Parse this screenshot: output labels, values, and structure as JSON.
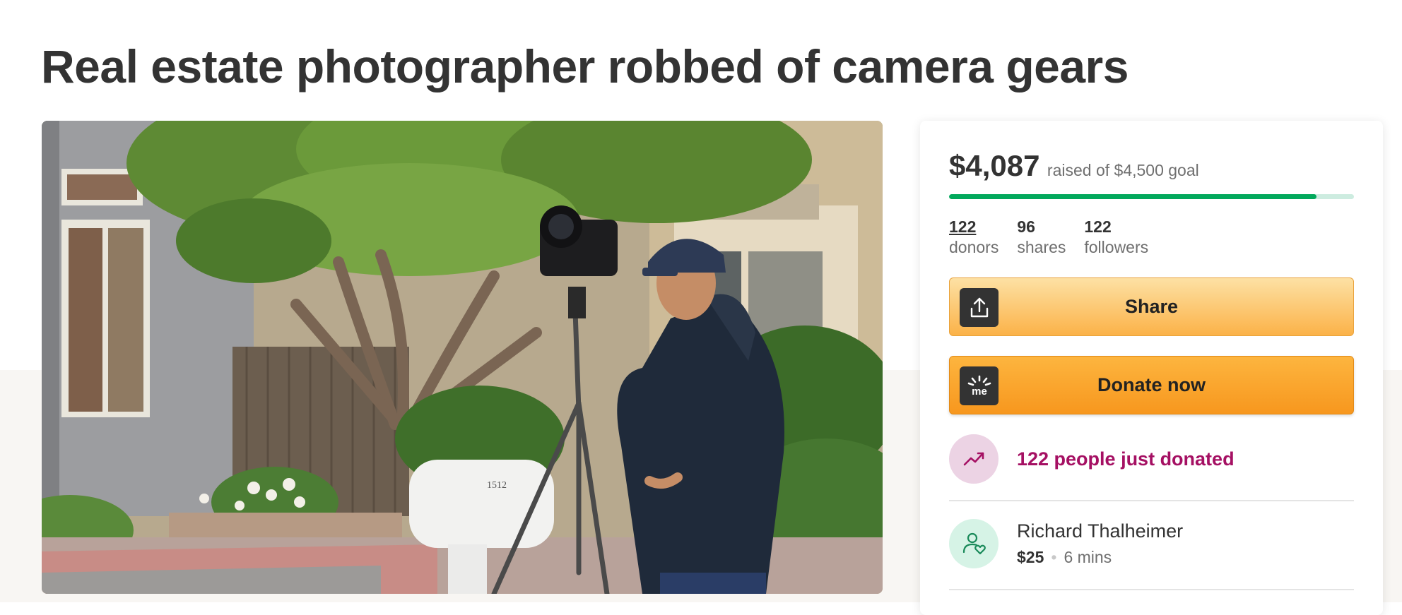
{
  "campaign": {
    "title": "Real estate photographer robbed of camera gears",
    "hero_image_alt": ""
  },
  "donation_card": {
    "amount_raised": "$4,087",
    "goal_text": "raised of $4,500 goal",
    "progress_fraction": 0.908,
    "stats": [
      {
        "value": "122",
        "label": "donors"
      },
      {
        "value": "96",
        "label": "shares"
      },
      {
        "value": "122",
        "label": "followers"
      }
    ],
    "share_button": {
      "label": "Share",
      "icon": "share-upload-icon"
    },
    "donate_button": {
      "label": "Donate now",
      "icon": "gofundme-logo-icon"
    },
    "recent_activity": {
      "text": "122 people just donated",
      "icon": "trending-up-icon"
    },
    "recent_donor": {
      "name": "Richard Thalheimer",
      "amount": "$25",
      "time": "6 mins",
      "icon": "donor-heart-icon"
    }
  },
  "colors": {
    "accent_green": "#02a95c",
    "progress_track": "#cdece0",
    "donate_orange": "#f7971e",
    "share_yellow": "#fbb248",
    "activity_magenta": "#a51063"
  }
}
